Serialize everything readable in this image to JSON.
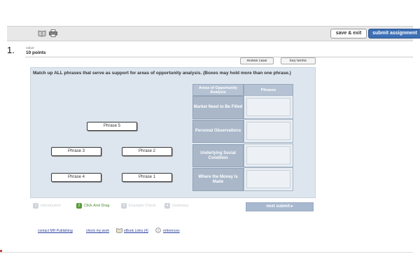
{
  "toolbar": {
    "icons": [
      "book-icon",
      "print-icon"
    ],
    "save_label": "save & exit",
    "submit_label": "submit assignment"
  },
  "question": {
    "number": "1.",
    "value_label": "value",
    "points": "10 points"
  },
  "buttons": {
    "review_case": "review case",
    "key_terms": "key terms"
  },
  "instructions": "Match up ALL phrases that serve as support for areas of opportunity analysis. (Boxes may hold more than one phrase.)",
  "phrases": [
    "Phrase 5",
    "Phrase 3",
    "Phrase 2",
    "Phrase 4",
    "Phrase 1"
  ],
  "table": {
    "col1_header": "Areas of Opportunity Analysis",
    "col2_header": "Phrases",
    "areas": [
      "Market Need to Be Filled",
      "Personal Observations",
      "Underlying Social Condition",
      "Where the Money Is Made"
    ]
  },
  "steps": [
    {
      "num": "1",
      "label": "Introduction"
    },
    {
      "num": "2",
      "label": "Click And Drag"
    },
    {
      "num": "3",
      "label": "Example Check"
    },
    {
      "num": "4",
      "label": "Summary"
    }
  ],
  "next_label": "next  submit ▸",
  "footer": {
    "contact": "contact MH Publishing",
    "check": "check my work",
    "ebook": "eBook Links (4)",
    "references": "references"
  },
  "colors": {
    "panel_bg": "#dde6ef",
    "header_bg": "#b4c2d3",
    "area_bg": "#a9b7c9",
    "submit_bg": "#3d6fb5",
    "active_step": "#5a9a3a",
    "link": "#2b3f9e"
  }
}
